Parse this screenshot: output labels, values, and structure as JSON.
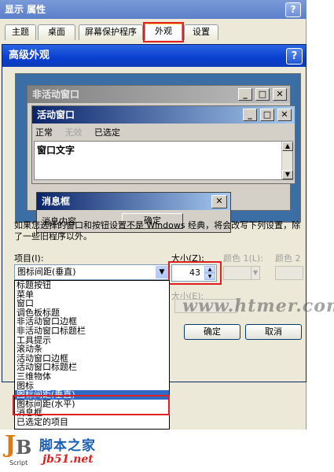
{
  "parent": {
    "title": "显示 属性",
    "help": "?",
    "tabs": [
      "主题",
      "桌面",
      "屏幕保护程序",
      "外观",
      "设置"
    ]
  },
  "advanced": {
    "title": "高级外观",
    "help": "?",
    "preview": {
      "inactive_title": "非活动窗口",
      "active_title": "活动窗口",
      "menu_normal": "正常",
      "menu_disabled": "无效",
      "menu_selected": "已选定",
      "window_text": "窗口文字",
      "msgbox_title": "消息框",
      "msgbox_text": "消息内容",
      "msgbox_ok": "确定",
      "min": "_",
      "max": "□",
      "close": "✕"
    },
    "description": "如果您选择的窗口和按钮设置不是 Windows 经典，将会改写下列设置，除了一些旧程序以外。",
    "item_label": "项目(I):",
    "size_label": "大小(Z):",
    "color1_label": "颜色 1(L):",
    "color2_label": "颜色 2",
    "size2_label": "大小(E):",
    "selected_item": "图标间距(垂直)",
    "size_value": "43",
    "ok": "确定",
    "cancel": "取消",
    "items": [
      "标题按钮",
      "菜单",
      "窗口",
      "调色板标题",
      "非活动窗口边框",
      "非活动窗口标题栏",
      "工具提示",
      "滚动条",
      "活动窗口边框",
      "活动窗口标题栏",
      "三维物体",
      "图标",
      "图标间距(垂直)",
      "图标间距(水平)",
      "消息框",
      "已选定的项目"
    ],
    "selected_index": 12
  },
  "watermark": {
    "site": "www.htmer.com",
    "brand_cn": "脚本之家",
    "brand_url": "jb51.net",
    "logo_script": "Script"
  }
}
